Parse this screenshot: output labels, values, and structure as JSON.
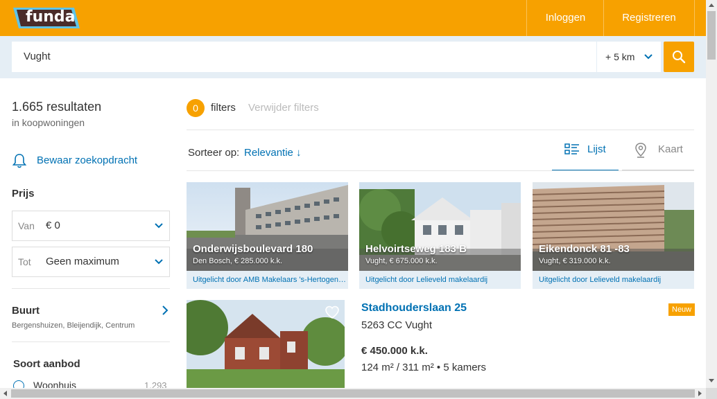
{
  "header": {
    "logo_text": "funda",
    "nav": {
      "login": "Inloggen",
      "register": "Registreren"
    },
    "brand_color": "#f7a100"
  },
  "search": {
    "value": "Vught",
    "radius": "+ 5 km"
  },
  "sidebar": {
    "results_count": "1.665 resultaten",
    "results_sub": "in koopwoningen",
    "save_search": "Bewaar zoekopdracht",
    "price": {
      "heading": "Prijs",
      "from_prefix": "Van",
      "from_value": "€ 0",
      "to_prefix": "Tot",
      "to_value": "Geen maximum"
    },
    "neighbourhood": {
      "heading": "Buurt",
      "subtitle": "Bergenshuizen, Bleijendijk, Centrum"
    },
    "offer_type": {
      "heading": "Soort aanbod",
      "option_label": "Woonhuis",
      "option_count": "1.293"
    }
  },
  "filters": {
    "count": "0",
    "label": "filters",
    "remove": "Verwijder filters"
  },
  "sort": {
    "label": "Sorteer op:",
    "value": "Relevantie ↓"
  },
  "view_tabs": {
    "list": "Lijst",
    "map": "Kaart"
  },
  "featured": [
    {
      "title": "Onderwijsboulevard 180",
      "meta": "Den Bosch, € 285.000 k.k.",
      "footer": "Uitgelicht door AMB Makelaars 's-Hertogenbosch"
    },
    {
      "title": "Helvoirtseweg 183 B",
      "meta": "Vught, € 675.000 k.k.",
      "footer": "Uitgelicht door Lelieveld makelaardij"
    },
    {
      "title": "Eikendonck 81 -83",
      "meta": "Vught, € 319.000 k.k.",
      "footer": "Uitgelicht door Lelieveld makelaardij"
    }
  ],
  "listing": {
    "title": "Stadhouderslaan 25",
    "subtitle": "5263 CC Vught",
    "price": "€ 450.000 k.k.",
    "specs": "124 m² / 311 m²  •  5 kamers",
    "badge": "Neuw"
  },
  "icons": [
    "bell-icon",
    "search-icon",
    "chevron-down-icon",
    "chevron-right-icon",
    "list-icon",
    "map-pin-icon",
    "heart-icon"
  ]
}
